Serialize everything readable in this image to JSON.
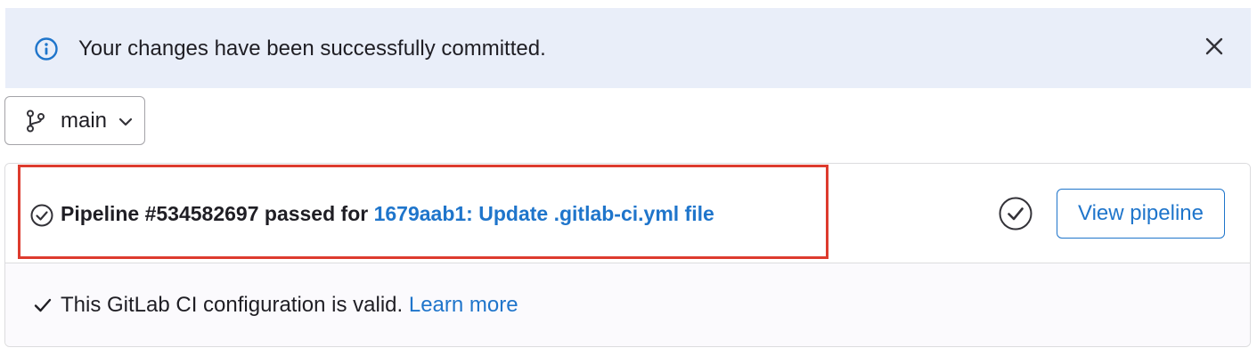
{
  "alert": {
    "message": "Your changes have been successfully committed.",
    "icon": "info-icon",
    "close_icon": "close-icon",
    "background": "#e9eef9"
  },
  "branch": {
    "label": "main",
    "icon": "branch-icon",
    "dropdown_icon": "chevron-down-icon"
  },
  "pipeline": {
    "status_text": "Pipeline #534582697 passed for",
    "commit_link": "1679aab1: Update .gitlab-ci.yml file",
    "status": "passed",
    "status_icon": "check-circle-icon",
    "view_button": "View pipeline",
    "highlight_color": "#dd3b2e"
  },
  "validation": {
    "message": "This GitLab CI configuration is valid.",
    "learn_more": "Learn more",
    "icon": "check-icon"
  },
  "colors": {
    "link": "#1f75cb",
    "text": "#1f1e24",
    "border": "#dcdcde"
  }
}
